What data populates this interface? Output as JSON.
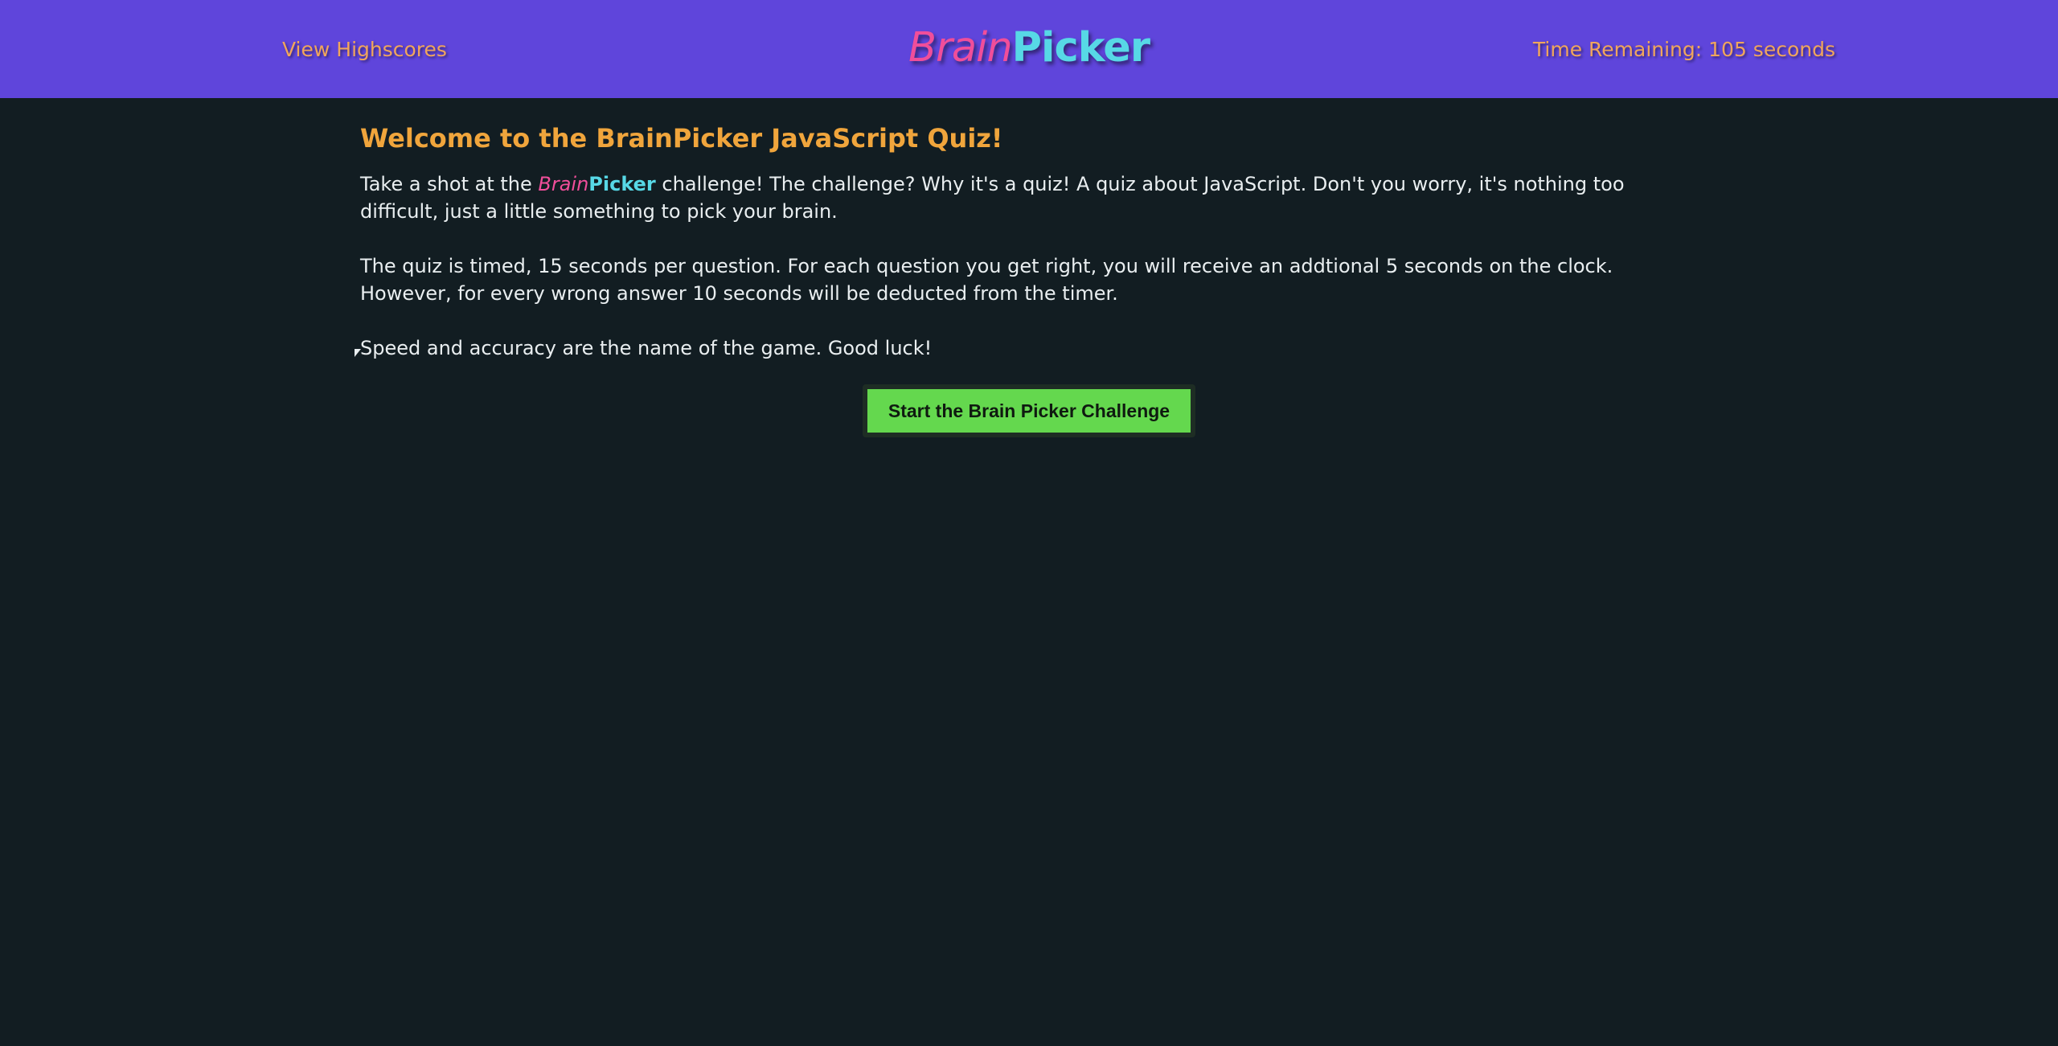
{
  "header": {
    "highscores_link": "View Highscores",
    "logo_part1": "Brain",
    "logo_part2": "Picker",
    "timer_text": "Time Remaining: 105 seconds"
  },
  "intro": {
    "title": "Welcome to the BrainPicker JavaScript Quiz!",
    "p1_before": "Take a shot at the ",
    "p1_brand_part1": "Brain",
    "p1_brand_part2": "Picker",
    "p1_after": " challenge! The challenge? Why it's a quiz! A quiz about JavaScript. Don't you worry, it's nothing too difficult, just a little something to pick your brain.",
    "p2": "The quiz is timed, 15 seconds per question. For each question you get right, you will receive an addtional 5 seconds on the clock. However, for every wrong answer 10 seconds will be deducted from the timer.",
    "p3": "Speed and accuracy are the name of the game. Good luck!"
  },
  "start_button": {
    "label": "Start the Brain Picker Challenge"
  },
  "colors": {
    "header_bg": "#5f45db",
    "page_bg": "#121d22",
    "accent_orange": "#f0a53c",
    "brand_pink": "#f04e9a",
    "brand_cyan": "#57d8e6",
    "button_green": "#64d84e"
  }
}
